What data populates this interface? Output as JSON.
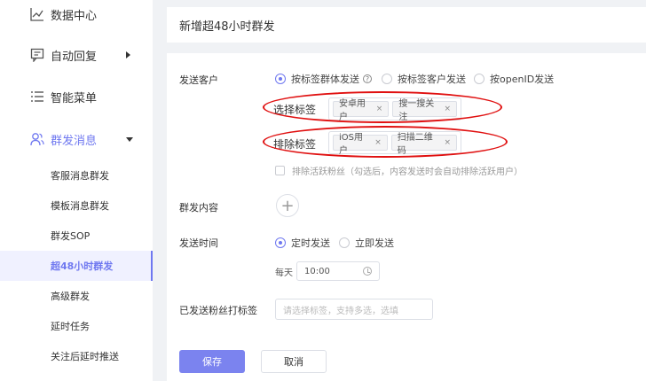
{
  "sidebar": {
    "items": [
      {
        "label": "数据中心"
      },
      {
        "label": "自动回复"
      },
      {
        "label": "智能菜单"
      },
      {
        "label": "群发消息"
      }
    ],
    "subitems": [
      {
        "label": "客服消息群发"
      },
      {
        "label": "模板消息群发"
      },
      {
        "label": "群发SOP"
      },
      {
        "label": "超48小时群发"
      },
      {
        "label": "高级群发"
      },
      {
        "label": "延时任务"
      },
      {
        "label": "关注后延时推送"
      }
    ]
  },
  "header": {
    "title": "新增超48小时群发"
  },
  "form": {
    "send_customer": {
      "label": "发送客户",
      "options": [
        "按标签群体发送",
        "按标签客户发送",
        "按openID发送"
      ],
      "selected": 0
    },
    "select_tags": {
      "label": "选择标签",
      "tags": [
        "安卓用户",
        "搜一搜关注"
      ]
    },
    "exclude_tags": {
      "label": "排除标签",
      "tags": [
        "iOS用户",
        "扫描二维码"
      ]
    },
    "exclude_active": {
      "label": "排除活跃粉丝（勾选后，内容发送时会自动排除活跃用户）"
    },
    "content": {
      "label": "群发内容",
      "add_symbol": "+"
    },
    "send_time": {
      "label": "发送时间",
      "options": [
        "定时发送",
        "立即发送"
      ],
      "selected": 0,
      "prefix": "每天",
      "time_value": "10:00"
    },
    "tagging": {
      "label": "已发送粉丝打标签",
      "placeholder": "请选择标签，支持多选，选填"
    },
    "buttons": {
      "save": "保存",
      "cancel": "取消"
    }
  },
  "colors": {
    "accent": "#6f78f0",
    "annotation": "#e01010"
  }
}
